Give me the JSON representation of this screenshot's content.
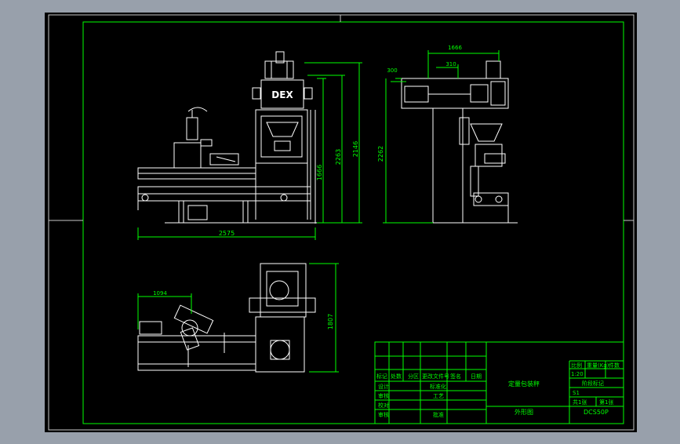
{
  "drawing": {
    "brand_label": "DEX",
    "dimensions": {
      "front_width": "2575",
      "front_height_1": "1666",
      "front_height_2": "2263",
      "front_height_3": "2146",
      "side_top_width": "1666",
      "side_top_offset": "310",
      "side_small": "300",
      "side_height": "2262",
      "plan_width": "1094",
      "plan_height": "1807"
    },
    "title_block": {
      "product_name": "定量包装秤",
      "drawing_name": "外形图",
      "drawing_no": "DCS50P",
      "scale_header": "比例",
      "scale_value": "1:20",
      "weight_header": "重量(Kg)",
      "parts_header": "件数",
      "stage_label": "阶段标记",
      "s1_label": "S1",
      "sheets_total": "共1张",
      "sheet_no": "第1张",
      "header_cells": [
        "标记",
        "处数",
        "分区",
        "更改文件号",
        "签名",
        "日期"
      ],
      "row_labels": [
        "设计",
        "审核",
        "校对",
        "审核"
      ],
      "std_label": "标准化",
      "process_label": "工艺",
      "approve_label": "批准"
    },
    "colors": {
      "background": "#98a0ab",
      "sheet": "#000000",
      "frame": "#00ff00",
      "machine": "#ffffff",
      "dimension": "#00ff00"
    }
  }
}
